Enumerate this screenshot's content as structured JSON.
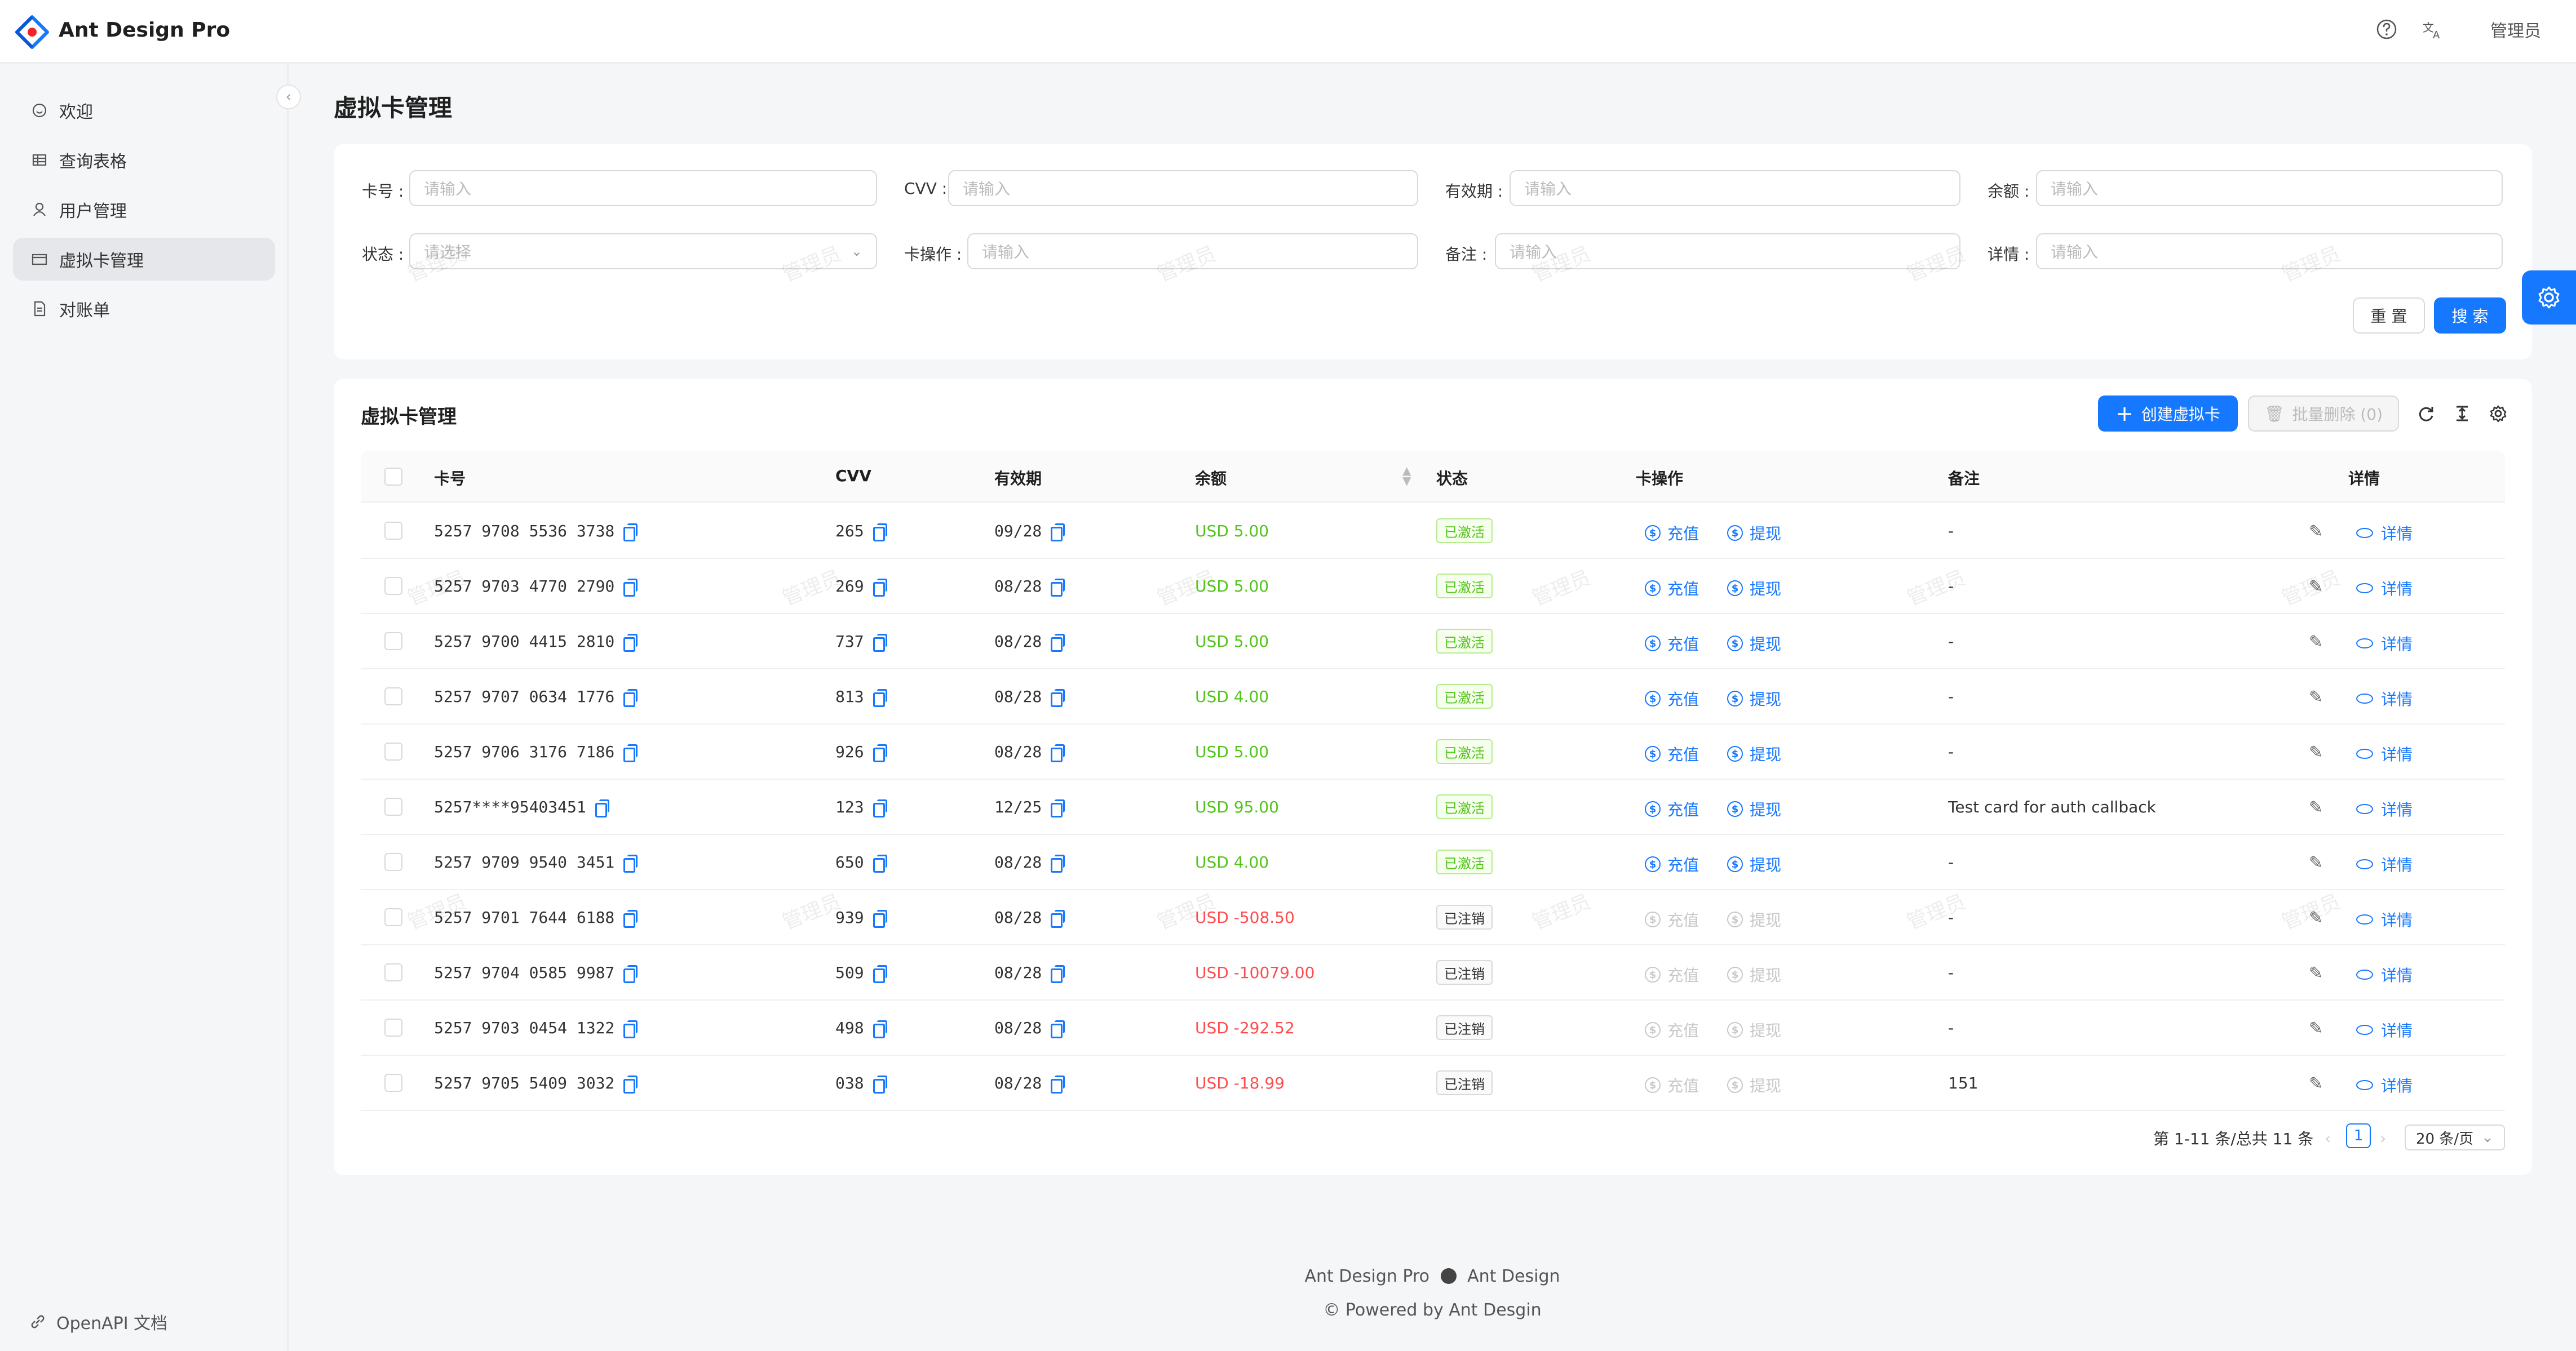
{
  "app": {
    "brand": "Ant Design Pro",
    "user": "管理员"
  },
  "nav": {
    "items": [
      {
        "label": "欢迎"
      },
      {
        "label": "查询表格"
      },
      {
        "label": "用户管理"
      },
      {
        "label": "虚拟卡管理"
      },
      {
        "label": "对账单"
      }
    ],
    "active": 3,
    "api": "OpenAPI 文档"
  },
  "page": {
    "title": "虚拟卡管理"
  },
  "search": {
    "fields": [
      {
        "label": "卡号 :",
        "placeholder": "请输入"
      },
      {
        "label": "CVV :",
        "placeholder": "请输入"
      },
      {
        "label": "有效期 :",
        "placeholder": "请输入"
      },
      {
        "label": "余额 :",
        "placeholder": "请输入"
      },
      {
        "label": "状态 :",
        "placeholder": "请选择"
      },
      {
        "label": "卡操作 :",
        "placeholder": "请输入"
      },
      {
        "label": "备注 :",
        "placeholder": "请输入"
      },
      {
        "label": "详情 :",
        "placeholder": "请输入"
      }
    ],
    "reset": "重 置",
    "submit": "搜 索"
  },
  "table": {
    "title": "虚拟卡管理",
    "create": "创建虚拟卡",
    "bulk_delete": "批量删除 (0)",
    "columns": [
      "卡号",
      "CVV",
      "有效期",
      "余额",
      "状态",
      "卡操作",
      "备注",
      "详情"
    ],
    "recharge": "充值",
    "withdraw": "提现",
    "detail": "详情",
    "rows": [
      {
        "card": "5257 9708 5536 3738",
        "cvv": "265",
        "exp": "09/28",
        "balance": "USD 5.00",
        "status": "已激活",
        "active": true,
        "note": "-"
      },
      {
        "card": "5257 9703 4770 2790",
        "cvv": "269",
        "exp": "08/28",
        "balance": "USD 5.00",
        "status": "已激活",
        "active": true,
        "note": "-"
      },
      {
        "card": "5257 9700 4415 2810",
        "cvv": "737",
        "exp": "08/28",
        "balance": "USD 5.00",
        "status": "已激活",
        "active": true,
        "note": "-"
      },
      {
        "card": "5257 9707 0634 1776",
        "cvv": "813",
        "exp": "08/28",
        "balance": "USD 4.00",
        "status": "已激活",
        "active": true,
        "note": "-"
      },
      {
        "card": "5257 9706 3176 7186",
        "cvv": "926",
        "exp": "08/28",
        "balance": "USD 5.00",
        "status": "已激活",
        "active": true,
        "note": "-"
      },
      {
        "card": "5257****95403451",
        "cvv": "123",
        "exp": "12/25",
        "balance": "USD 95.00",
        "status": "已激活",
        "active": true,
        "note": "Test card for auth callback"
      },
      {
        "card": "5257 9709 9540 3451",
        "cvv": "650",
        "exp": "08/28",
        "balance": "USD 4.00",
        "status": "已激活",
        "active": true,
        "note": "-"
      },
      {
        "card": "5257 9701 7644 6188",
        "cvv": "939",
        "exp": "08/28",
        "balance": "USD -508.50",
        "status": "已注销",
        "active": false,
        "note": "-"
      },
      {
        "card": "5257 9704 0585 9987",
        "cvv": "509",
        "exp": "08/28",
        "balance": "USD -10079.00",
        "status": "已注销",
        "active": false,
        "note": "-"
      },
      {
        "card": "5257 9703 0454 1322",
        "cvv": "498",
        "exp": "08/28",
        "balance": "USD -292.52",
        "status": "已注销",
        "active": false,
        "note": "-"
      },
      {
        "card": "5257 9705 5409 3032",
        "cvv": "038",
        "exp": "08/28",
        "balance": "USD -18.99",
        "status": "已注销",
        "active": false,
        "note": "151"
      }
    ]
  },
  "pagination": {
    "summary": "第 1-11 条/总共 11 条",
    "page": "1",
    "size": "20 条/页"
  },
  "footer": {
    "links": "Ant Design Pro",
    "github": "Ant Design",
    "copyright": "Powered by Ant Desgin"
  },
  "watermark": "管理员",
  "colors": {
    "primary": "#1677ff",
    "success": "#52c41a",
    "danger": "#ff4d4f"
  }
}
